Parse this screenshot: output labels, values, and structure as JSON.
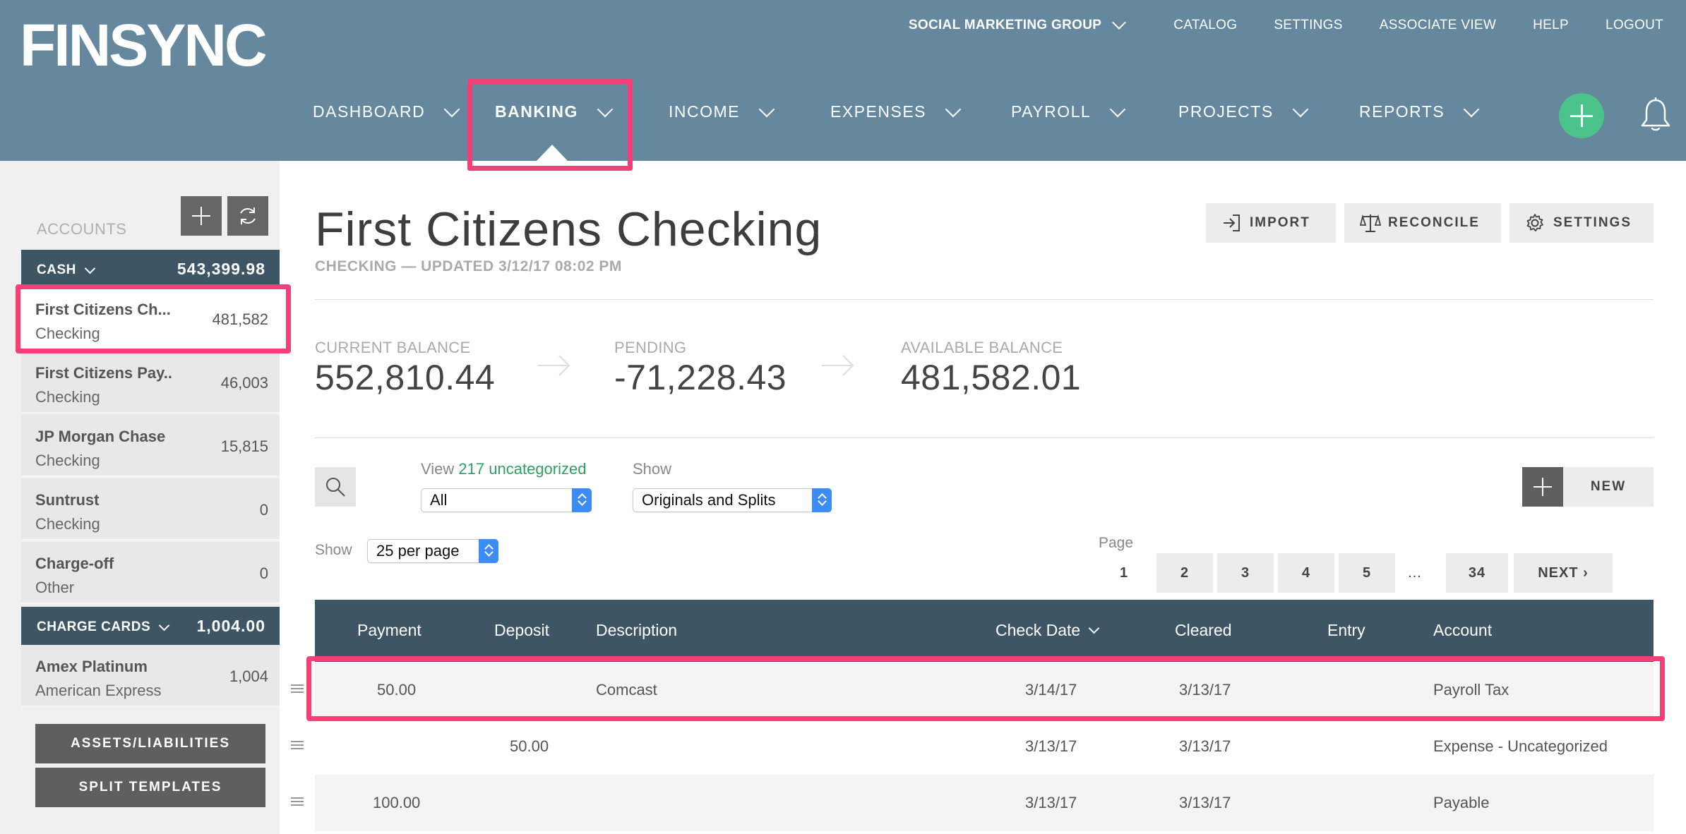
{
  "header": {
    "logo": "FINSYNC",
    "org_name": "SOCIAL MARKETING GROUP",
    "top_links": [
      "CATALOG",
      "SETTINGS",
      "ASSOCIATE VIEW",
      "HELP",
      "LOGOUT"
    ],
    "main_nav": [
      "DASHBOARD",
      "BANKING",
      "INCOME",
      "EXPENSES",
      "PAYROLL",
      "PROJECTS",
      "REPORTS"
    ],
    "active_nav": "BANKING",
    "icons": [
      "add-circle-icon",
      "bell-icon"
    ]
  },
  "sidebar": {
    "accounts_label": "ACCOUNTS",
    "groups": [
      {
        "name": "CASH",
        "total": "543,399.98",
        "accounts": [
          {
            "name": "First Citizens Ch...",
            "type": "Checking",
            "balance": "481,582",
            "selected": true
          },
          {
            "name": "First Citizens Pay..",
            "type": "Checking",
            "balance": "46,003"
          },
          {
            "name": "JP Morgan Chase",
            "type": "Checking",
            "balance": "15,815"
          },
          {
            "name": "Suntrust",
            "type": "Checking",
            "balance": "0"
          },
          {
            "name": "Charge-off",
            "type": "Other",
            "balance": "0"
          }
        ]
      },
      {
        "name": "CHARGE CARDS",
        "total": "1,004.00",
        "accounts": [
          {
            "name": "Amex Platinum",
            "type": "American Express",
            "balance": "1,004"
          }
        ]
      }
    ],
    "buttons": {
      "assets": "ASSETS/LIABILITIES",
      "splits": "SPLIT TEMPLATES"
    }
  },
  "main": {
    "title": "First Citizens Checking",
    "subtitle": "CHECKING — UPDATED 3/12/17 08:02 PM",
    "actions": {
      "import": "IMPORT",
      "reconcile": "RECONCILE",
      "settings": "SETTINGS"
    },
    "balances": {
      "current_label": "CURRENT BALANCE",
      "current_value": "552,810.44",
      "pending_label": "PENDING",
      "pending_value": "-71,228.43",
      "available_label": "AVAILABLE BALANCE",
      "available_value": "481,582.01"
    },
    "filters": {
      "view_prefix": "View",
      "uncategorized_count": "217",
      "uncategorized_word": "uncategorized",
      "view_value": "All",
      "show_label": "Show",
      "show_value": "Originals and Splits",
      "per_page_label": "Show",
      "per_page_value": "25 per page"
    },
    "new_label": "NEW",
    "pagination": {
      "label": "Page",
      "current": "1",
      "pages": [
        "2",
        "3",
        "4",
        "5"
      ],
      "ellipsis": "...",
      "last": "34",
      "next": "NEXT ›"
    },
    "table": {
      "headers": [
        "Payment",
        "Deposit",
        "Description",
        "Check Date",
        "Cleared",
        "Entry",
        "Account"
      ],
      "rows": [
        {
          "payment": "50.00",
          "deposit": "",
          "description": "Comcast",
          "check_date": "3/14/17",
          "cleared": "3/13/17",
          "entry": "",
          "account": "Payroll Tax"
        },
        {
          "payment": "",
          "deposit": "50.00",
          "description": "",
          "check_date": "3/13/17",
          "cleared": "3/13/17",
          "entry": "",
          "account": "Expense - Uncategorized"
        },
        {
          "payment": "100.00",
          "deposit": "",
          "description": "",
          "check_date": "3/13/17",
          "cleared": "3/13/17",
          "entry": "",
          "account": "Payable"
        }
      ]
    }
  },
  "colors": {
    "header": "#66889f",
    "dark": "#3e5565",
    "highlight": "#f43f77",
    "green": "#4cc38a"
  }
}
